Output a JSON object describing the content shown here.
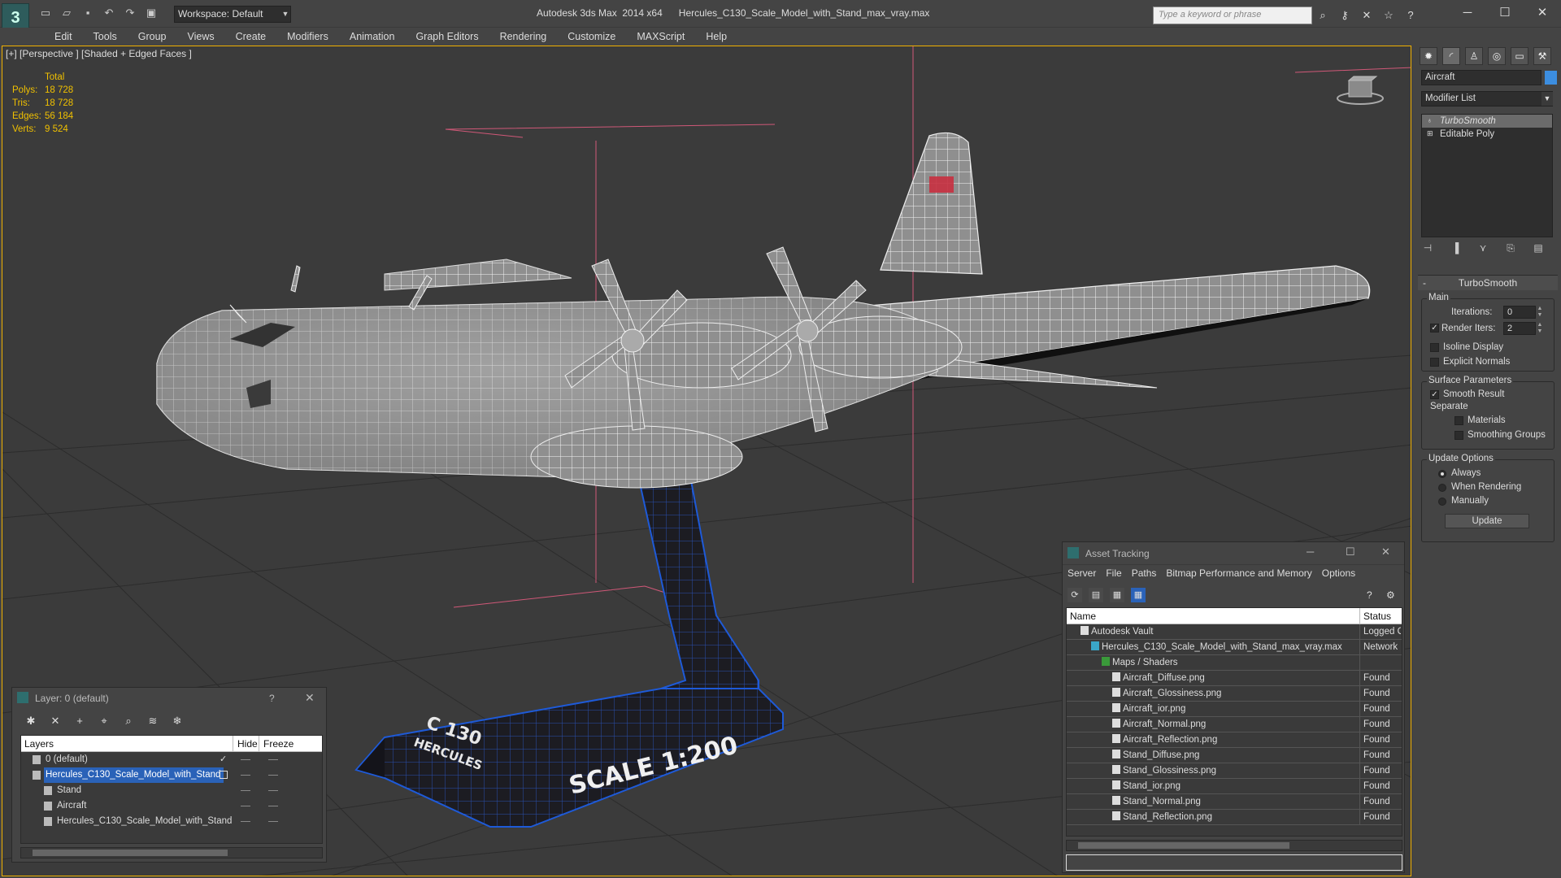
{
  "titlebar": {
    "workspace": "Workspace: Default",
    "app_title": "Autodesk 3ds Max  2014 x64",
    "file_title": "Hercules_C130_Scale_Model_with_Stand_max_vray.max",
    "search_placeholder": "Type a keyword or phrase"
  },
  "menu": [
    "Edit",
    "Tools",
    "Group",
    "Views",
    "Create",
    "Modifiers",
    "Animation",
    "Graph Editors",
    "Rendering",
    "Customize",
    "MAXScript",
    "Help"
  ],
  "viewport": {
    "label": "[+] [Perspective ] [Shaded + Edged Faces ]",
    "stats": {
      "header": "Total",
      "rows": [
        {
          "k": "Polys:",
          "v": "18 728"
        },
        {
          "k": "Tris:",
          "v": "18 728"
        },
        {
          "k": "Edges:",
          "v": "56 184"
        },
        {
          "k": "Verts:",
          "v": "9 524"
        }
      ]
    },
    "stand_text_1": "C 130",
    "stand_text_2": "HERCULES",
    "stand_text_3": "SCALE 1:200"
  },
  "command_panel": {
    "object_name": "Aircraft",
    "modifier_list": "Modifier List",
    "stack": [
      "TurboSmooth",
      "Editable Poly"
    ],
    "rollout_title": "TurboSmooth",
    "main_group": "Main",
    "iterations_label": "Iterations:",
    "iterations_value": "0",
    "render_iters_label": "Render Iters:",
    "render_iters_value": "2",
    "isoline": "Isoline Display",
    "explicit_normals": "Explicit Normals",
    "surface_group": "Surface Parameters",
    "smooth_result": "Smooth Result",
    "separate": "Separate",
    "materials": "Materials",
    "smoothing_groups": "Smoothing Groups",
    "update_group": "Update Options",
    "always": "Always",
    "when_rendering": "When Rendering",
    "manually": "Manually",
    "update_button": "Update"
  },
  "asset_tracking": {
    "title": "Asset Tracking",
    "menu": [
      "Server",
      "File",
      "Paths",
      "Bitmap Performance and Memory",
      "Options"
    ],
    "col_name": "Name",
    "col_status": "Status",
    "rows": [
      {
        "name": "Autodesk Vault",
        "status": "Logged O",
        "indent": 1
      },
      {
        "name": "Hercules_C130_Scale_Model_with_Stand_max_vray.max",
        "status": "Network",
        "indent": 2
      },
      {
        "name": "Maps / Shaders",
        "status": "",
        "indent": 3
      },
      {
        "name": "Aircraft_Diffuse.png",
        "status": "Found",
        "indent": 4
      },
      {
        "name": "Aircraft_Glossiness.png",
        "status": "Found",
        "indent": 4
      },
      {
        "name": "Aircraft_ior.png",
        "status": "Found",
        "indent": 4
      },
      {
        "name": "Aircraft_Normal.png",
        "status": "Found",
        "indent": 4
      },
      {
        "name": "Aircraft_Reflection.png",
        "status": "Found",
        "indent": 4
      },
      {
        "name": "Stand_Diffuse.png",
        "status": "Found",
        "indent": 4
      },
      {
        "name": "Stand_Glossiness.png",
        "status": "Found",
        "indent": 4
      },
      {
        "name": "Stand_ior.png",
        "status": "Found",
        "indent": 4
      },
      {
        "name": "Stand_Normal.png",
        "status": "Found",
        "indent": 4
      },
      {
        "name": "Stand_Reflection.png",
        "status": "Found",
        "indent": 4
      }
    ]
  },
  "layer_dialog": {
    "title": "Layer: 0 (default)",
    "help": "?",
    "col_layers": "Layers",
    "col_hide": "Hide",
    "col_freeze": "Freeze",
    "rows": [
      {
        "name": "0 (default)",
        "indent": 1,
        "selected": false
      },
      {
        "name": "Hercules_C130_Scale_Model_with_Stand",
        "indent": 1,
        "selected": true
      },
      {
        "name": "Stand",
        "indent": 2,
        "selected": false
      },
      {
        "name": "Aircraft",
        "indent": 2,
        "selected": false
      },
      {
        "name": "Hercules_C130_Scale_Model_with_Stand",
        "indent": 2,
        "selected": false
      }
    ]
  },
  "colors": {
    "accent": "#2a62b8",
    "viewport_border": "#f0b000",
    "stats": "#f0c000",
    "wire_blue": "#1e5ad8"
  }
}
